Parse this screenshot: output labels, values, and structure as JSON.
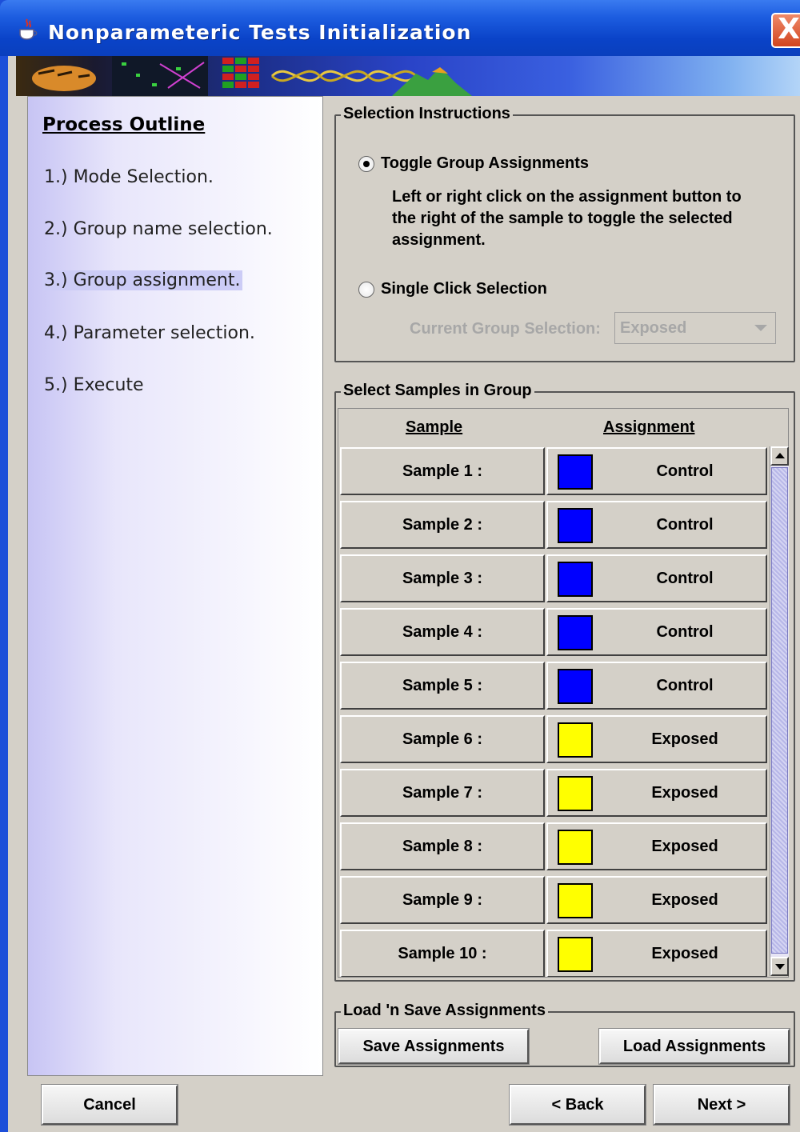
{
  "window": {
    "title": "Nonparameteric Tests Initialization",
    "close_symbol": "X"
  },
  "outline": {
    "title": "Process Outline",
    "steps": [
      "1.) Mode Selection.",
      "2.) Group name selection.",
      "3.) Group assignment.",
      "4.) Parameter selection.",
      "5.) Execute"
    ],
    "current_step": 3
  },
  "selection": {
    "group_title": "Selection Instructions",
    "toggle_label": "Toggle Group Assignments",
    "toggle_checked": true,
    "instructions": [
      "Left or right click on the assignment button to",
      "the right of the sample to toggle the selected",
      "assignment."
    ],
    "single_click_label": "Single Click Selection",
    "current_group_label": "Current Group Selection:",
    "current_group_value": "Exposed"
  },
  "samples": {
    "group_title": "Select Samples in Group",
    "col_sample": "Sample",
    "col_assignment": "Assignment",
    "rows": [
      {
        "sample": "Sample 1 :",
        "assignment": "Control",
        "color": "#0000ff"
      },
      {
        "sample": "Sample 2 :",
        "assignment": "Control",
        "color": "#0000ff"
      },
      {
        "sample": "Sample 3 :",
        "assignment": "Control",
        "color": "#0000ff"
      },
      {
        "sample": "Sample 4 :",
        "assignment": "Control",
        "color": "#0000ff"
      },
      {
        "sample": "Sample 5 :",
        "assignment": "Control",
        "color": "#0000ff"
      },
      {
        "sample": "Sample 6 :",
        "assignment": "Exposed",
        "color": "#ffff00"
      },
      {
        "sample": "Sample 7 :",
        "assignment": "Exposed",
        "color": "#ffff00"
      },
      {
        "sample": "Sample 8 :",
        "assignment": "Exposed",
        "color": "#ffff00"
      },
      {
        "sample": "Sample 9 :",
        "assignment": "Exposed",
        "color": "#ffff00"
      },
      {
        "sample": "Sample 10 :",
        "assignment": "Exposed",
        "color": "#ffff00"
      }
    ]
  },
  "load_save": {
    "group_title": "Load 'n Save Assignments",
    "save_label": "Save Assignments",
    "load_label": "Load Assignments"
  },
  "footer": {
    "cancel_label": "Cancel",
    "back_label": "< Back",
    "next_label": "Next >"
  }
}
